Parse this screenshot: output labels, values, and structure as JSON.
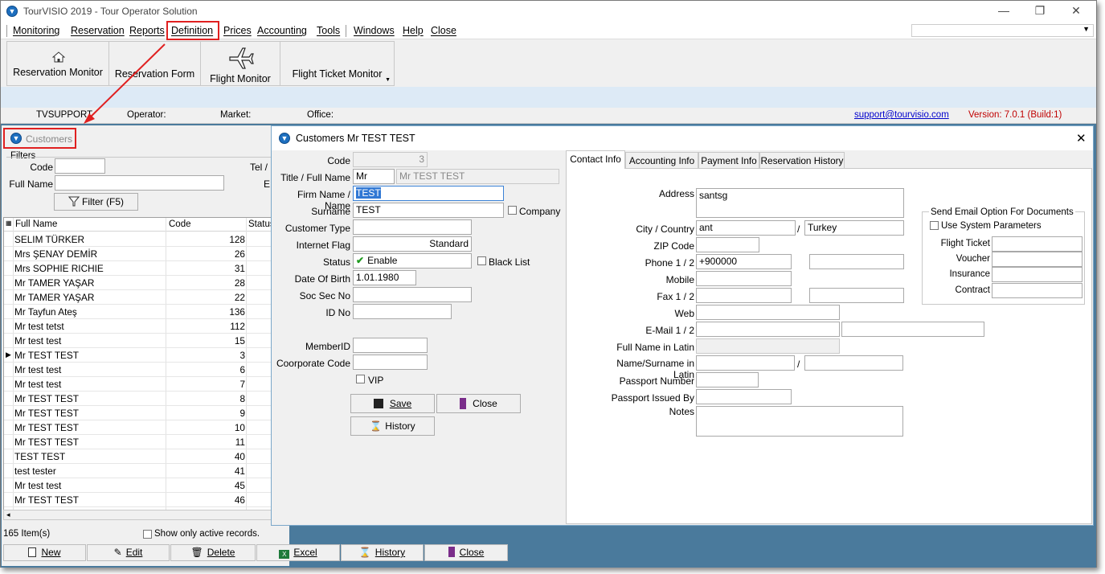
{
  "app": {
    "title": "TourVISIO 2019 - Tour Operator Solution"
  },
  "menu": [
    "Monitoring",
    "Reservation",
    "Reports",
    "Definition",
    "Prices",
    "Accounting",
    "Tools",
    "Windows",
    "Help",
    "Close"
  ],
  "toolbar": {
    "reservation_monitor": "Reservation Monitor",
    "reservation_form": "Reservation Form",
    "flight_monitor": "Flight Monitor",
    "flight_ticket_monitor": "Flight Ticket Monitor"
  },
  "status": {
    "user": "TVSUPPORT",
    "operator_label": "Operator:",
    "market_label": "Market:",
    "office_label": "Office:",
    "support_link": "support@tourvisio.com",
    "version": "Version: 7.0.1 (Build:1)"
  },
  "customers": {
    "title": "Customers",
    "filters_label": "Filters",
    "code_label": "Code",
    "tel_label": "Tel /",
    "fullname_label": "Full Name",
    "e_label": "E",
    "filter_button": "Filter (F5)",
    "columns": [
      "Full Name",
      "Code",
      "Status"
    ],
    "rows": [
      {
        "name": "SELIM TÜRKER",
        "code": "128"
      },
      {
        "name": "Mrs ŞENAY DEMİR",
        "code": "26"
      },
      {
        "name": "Mrs SOPHIE RICHIE",
        "code": "31"
      },
      {
        "name": "Mr TAMER YAŞAR",
        "code": "28"
      },
      {
        "name": "Mr TAMER  YAŞAR",
        "code": "22"
      },
      {
        "name": "Mr Tayfun Ateş",
        "code": "136"
      },
      {
        "name": "Mr test tetst",
        "code": "112"
      },
      {
        "name": "Mr test test",
        "code": "15"
      },
      {
        "name": "Mr TEST TEST",
        "code": "3"
      },
      {
        "name": "Mr test test",
        "code": "6"
      },
      {
        "name": "Mr test test",
        "code": "7"
      },
      {
        "name": "Mr TEST TEST",
        "code": "8"
      },
      {
        "name": "Mr TEST TEST",
        "code": "9"
      },
      {
        "name": "Mr TEST TEST",
        "code": "10"
      },
      {
        "name": "Mr TEST TEST",
        "code": "11"
      },
      {
        "name": "TEST TEST",
        "code": "40"
      },
      {
        "name": "test tester",
        "code": "41"
      },
      {
        "name": "Mr test test",
        "code": "45"
      },
      {
        "name": "Mr TEST TEST",
        "code": "46"
      }
    ],
    "item_count": "165 Item(s)",
    "show_active": "Show only active records.",
    "buttons": {
      "new": "New",
      "edit": "Edit",
      "delete": "Delete",
      "excel": "Excel",
      "history": "History",
      "close": "Close"
    }
  },
  "dialog": {
    "title": "Customers Mr TEST TEST",
    "labels": {
      "code": "Code",
      "title_fullname": "Title / Full Name",
      "firm_name": "Firm Name / Name",
      "surname": "Surname",
      "customer_type": "Customer Type",
      "internet_flag": "Internet Flag",
      "status": "Status",
      "dob": "Date Of Birth",
      "soc_sec": "Soc Sec No",
      "id_no": "ID No",
      "member_id": "MemberID",
      "corp_code": "Coorporate Code",
      "company": "Company",
      "black_list": "Black List",
      "vip": "VIP"
    },
    "values": {
      "code": "3",
      "title": "Mr",
      "fullname": "Mr TEST TEST",
      "firm_name": "TEST",
      "surname": "TEST",
      "internet_flag": "Standard",
      "status": "Enable",
      "dob": "1.01.1980"
    },
    "buttons": {
      "save": "Save",
      "close": "Close",
      "history": "History"
    },
    "tabs": [
      "Contact Info",
      "Accounting  Info",
      "Payment Info",
      "Reservation History"
    ],
    "contact": {
      "labels": {
        "address": "Address",
        "city_country": "City / Country",
        "zip": "ZIP Code",
        "phone": "Phone 1 / 2",
        "mobile": "Mobile",
        "fax": "Fax 1 / 2",
        "web": "Web",
        "email": "E-Mail 1 / 2",
        "fullname_latin": "Full Name in Latin",
        "name_surname_latin": "Name/Surname in Latin",
        "passport_no": "Passport Number",
        "passport_issued": "Passport Issued By",
        "notes": "Notes"
      },
      "values": {
        "address": "santsg",
        "city": "ant",
        "country": "Turkey",
        "phone1": "+900000"
      },
      "slash": "/"
    },
    "email_options": {
      "title": "Send Email Option For Documents",
      "use_system": "Use System Parameters",
      "flight_ticket": "Flight Ticket",
      "voucher": "Voucher",
      "insurance": "Insurance",
      "contract": "Contract"
    }
  }
}
